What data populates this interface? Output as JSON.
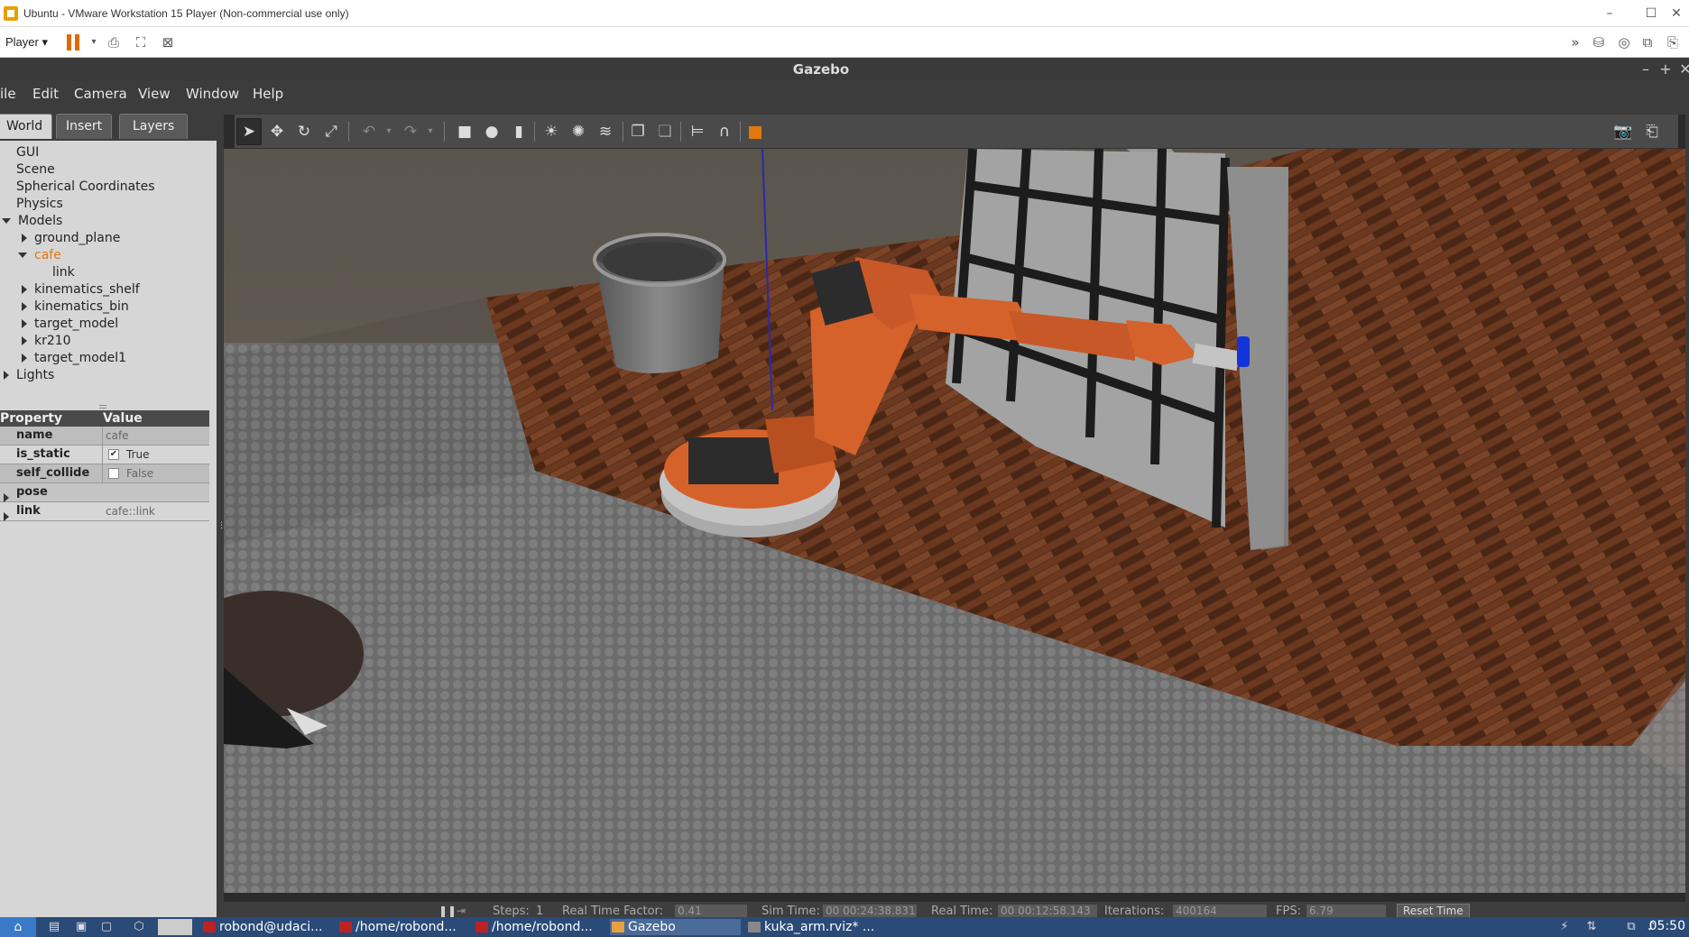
{
  "vm": {
    "title": "Ubuntu - VMware Workstation 15 Player (Non-commercial use only)",
    "player_label": "Player ▾"
  },
  "gazebo": {
    "title": "Gazebo",
    "menu": [
      "ile",
      "Edit",
      "Camera",
      "View",
      "Window",
      "Help"
    ]
  },
  "tabs": [
    "World",
    "Insert",
    "Layers"
  ],
  "tree": {
    "root_items": [
      "GUI",
      "Scene",
      "Spherical Coordinates",
      "Physics"
    ],
    "models_label": "Models",
    "models": [
      "ground_plane",
      "cafe",
      "kinematics_shelf",
      "kinematics_bin",
      "target_model",
      "kr210",
      "target_model1"
    ],
    "cafe_child": "link",
    "lights_label": "Lights"
  },
  "properties": {
    "header_property": "Property",
    "header_value": "Value",
    "rows": [
      {
        "key": "name",
        "value": "cafe"
      },
      {
        "key": "is_static",
        "value": "True",
        "checked": true
      },
      {
        "key": "self_collide",
        "value": "False",
        "checked": false
      },
      {
        "key": "pose",
        "value": ""
      },
      {
        "key": "link",
        "value": "cafe::link"
      }
    ]
  },
  "statusbar": {
    "steps_label": "Steps:",
    "steps_value": "1",
    "rtf_label": "Real Time Factor:",
    "rtf_value": "0.41",
    "sim_label": "Sim Time:",
    "sim_value": "00 00:24:38.831",
    "real_label": "Real Time:",
    "real_value": "00 00:12:58.143",
    "iter_label": "Iterations:",
    "iter_value": "400164",
    "fps_label": "FPS:",
    "fps_value": "6.79",
    "reset_label": "Reset Time"
  },
  "taskbar": {
    "tasks": [
      "robond@udaci...",
      "/home/robond...",
      "/home/robond...",
      "Gazebo",
      "kuka_arm.rviz* ..."
    ],
    "clock": "05:50"
  },
  "colors": {
    "accent": "#e07a10",
    "robot": "#d5622a",
    "floor_wood": "#5a2f1a",
    "floor_tile": "#7a7a7a"
  }
}
